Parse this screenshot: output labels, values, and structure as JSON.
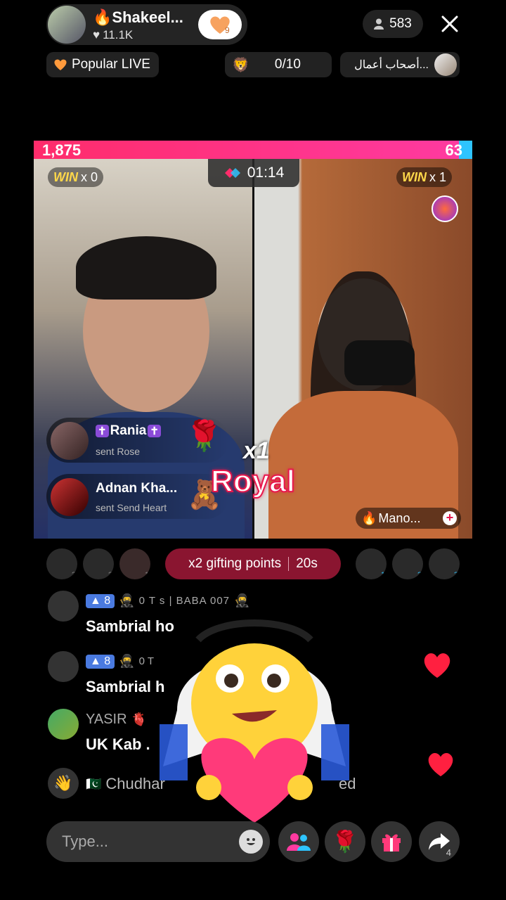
{
  "host": {
    "name": "Shakeel...",
    "likes": "11.1K",
    "follow_badge": "9",
    "viewers": "583"
  },
  "tags": {
    "popular": "Popular LIVE",
    "goal": "0/10",
    "partner": "...أصحاب أعمال"
  },
  "battle": {
    "left_score": "1,875",
    "right_score": "63",
    "left_fraction": 0.97,
    "timer": "01:14",
    "left_win": "x 0",
    "right_win": "x 1",
    "win_word": "WIN",
    "right_host": "Mano...",
    "multiplier": "x1",
    "gift_name": "Royal"
  },
  "gift_notices": [
    {
      "name": "Rania",
      "action": "sent Rose"
    },
    {
      "name": "Adnan Kha...",
      "action": "sent Send Heart"
    }
  ],
  "boost": {
    "label": "x2 gifting points",
    "time": "20s"
  },
  "supporters_left_ranks": [
    "3",
    "2",
    "1"
  ],
  "supporters_right_ranks": [
    "1",
    "2",
    "3"
  ],
  "comments": [
    {
      "level": "8",
      "badge_text": "0 T s | BABA 007",
      "name": "",
      "text": "Sambrial ho"
    },
    {
      "level": "8",
      "badge_text": "0 T",
      "name": "",
      "text": "Sambrial h"
    },
    {
      "level": "",
      "badge_text": "",
      "name": "YASIR",
      "text": "UK Kab ."
    },
    {
      "level": "",
      "badge_text": "",
      "name": "Chudhar",
      "text": "",
      "trailing": "ed"
    }
  ],
  "input": {
    "placeholder": "Type..."
  },
  "share_count": "4",
  "colors": {
    "accent_pink": "#ff2c6b",
    "blue": "#2ec4ff",
    "win_yellow": "#ffd84a"
  }
}
